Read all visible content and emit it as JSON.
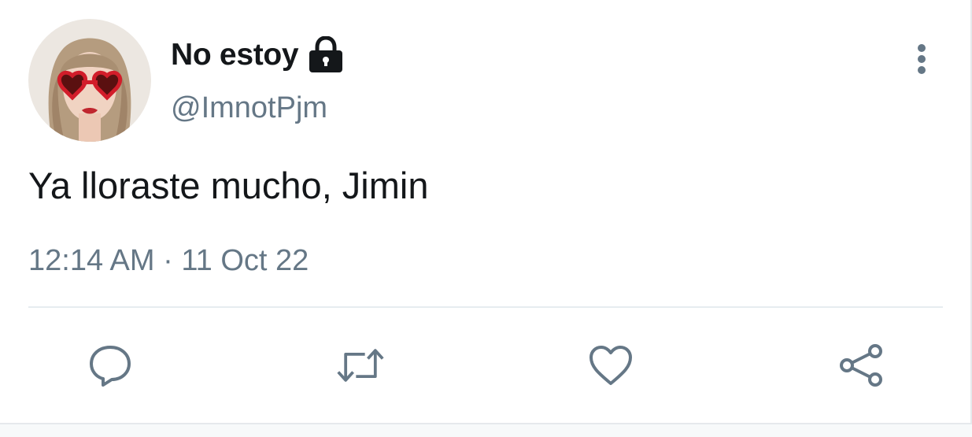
{
  "user": {
    "display_name": "No estoy",
    "handle": "@ImnotPjm",
    "protected_icon": "lock-icon",
    "avatar_icon": "avatar"
  },
  "tweet": {
    "text": "Ya lloraste mucho, Jimin",
    "time": "12:14 AM",
    "separator": "·",
    "date": "11 Oct 22"
  },
  "actions": {
    "reply_icon": "reply-icon",
    "retweet_icon": "retweet-icon",
    "like_icon": "heart-icon",
    "share_icon": "share-icon",
    "more_icon": "more-vertical-icon"
  },
  "colors": {
    "text_primary": "#14171a",
    "text_secondary": "#657786",
    "icon_color": "#657786",
    "divider": "#e6ecf0",
    "background": "#ffffff"
  }
}
